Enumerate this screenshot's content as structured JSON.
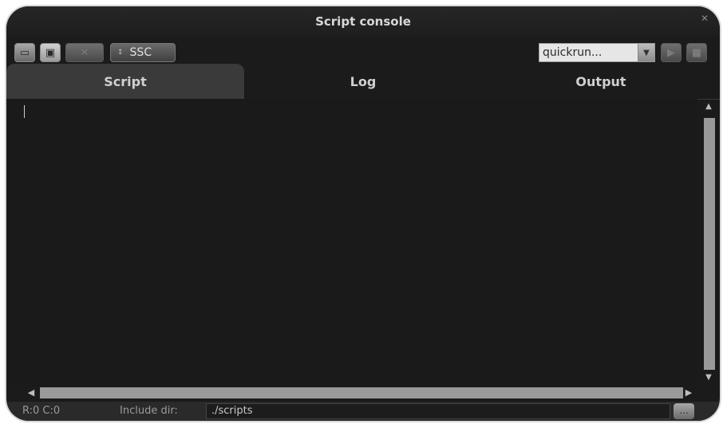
{
  "window": {
    "title": "Script console"
  },
  "toolbar": {
    "open_icon": "folder-icon",
    "save_icon": "save-icon",
    "clear_icon": "eraser-icon",
    "mode_label": "SSC",
    "mode_arrows": "↕",
    "quickrun_value": "quickrun...",
    "quickrun_dropdown_icon": "triangle-down-icon",
    "run_icon": "play-icon",
    "stop_icon": "stop-icon"
  },
  "tabs": [
    {
      "label": "Script",
      "active": true
    },
    {
      "label": "Log",
      "active": false
    },
    {
      "label": "Output",
      "active": false
    }
  ],
  "editor": {
    "content": ""
  },
  "status": {
    "rc": "R:0 C:0",
    "include_label": "Include dir:",
    "include_value": "./scripts",
    "browse_label": "..."
  },
  "colors": {
    "background": "#1b1b1c",
    "tab_active": "#3a3a3b",
    "scrollbar": "#9a9a9a"
  }
}
